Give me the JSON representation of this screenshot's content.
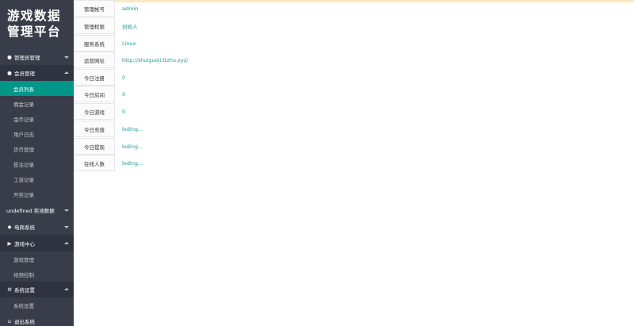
{
  "app": {
    "title_line1": "游戏数据",
    "title_line2": "管理平台"
  },
  "sidebar": {
    "admin_manage": "管理员管理",
    "member_manage": "会员管理",
    "member_items": [
      "会员列表",
      "佣金记录",
      "金币记录",
      "用户日志",
      "货币管理",
      "投注记录",
      "工资记录",
      "开奖记录"
    ],
    "reward_data": "undefined 奖池数据",
    "ecommerce": "电商系统",
    "game_center": "游戏中心",
    "game_items": [
      "游戏管理",
      "视频控制"
    ],
    "system_settings": "系统设置",
    "system_items": [
      "系统设置"
    ],
    "logout": "退出系统"
  },
  "info_rows": [
    {
      "label": "管理帐号",
      "value": "admin"
    },
    {
      "label": "管理权限",
      "value": "创始人"
    },
    {
      "label": "服务系统",
      "value": "Linux"
    },
    {
      "label": "运营网址",
      "value": "http://shuiguoji.ttzhu.xyz/"
    },
    {
      "label": "今日注册",
      "value": "0"
    },
    {
      "label": "今日房间",
      "value": "0"
    },
    {
      "label": "今日游戏",
      "value": "0"
    },
    {
      "label": "今日充值",
      "value": "loding..."
    },
    {
      "label": "今日提现",
      "value": "loding..."
    },
    {
      "label": "在线人数",
      "value": "loding..."
    }
  ],
  "colors": {
    "sidebar_bg": "#393d49",
    "sidebar_open_bg": "#2f3340",
    "active_item": "#009688",
    "value_text": "#15998c"
  }
}
